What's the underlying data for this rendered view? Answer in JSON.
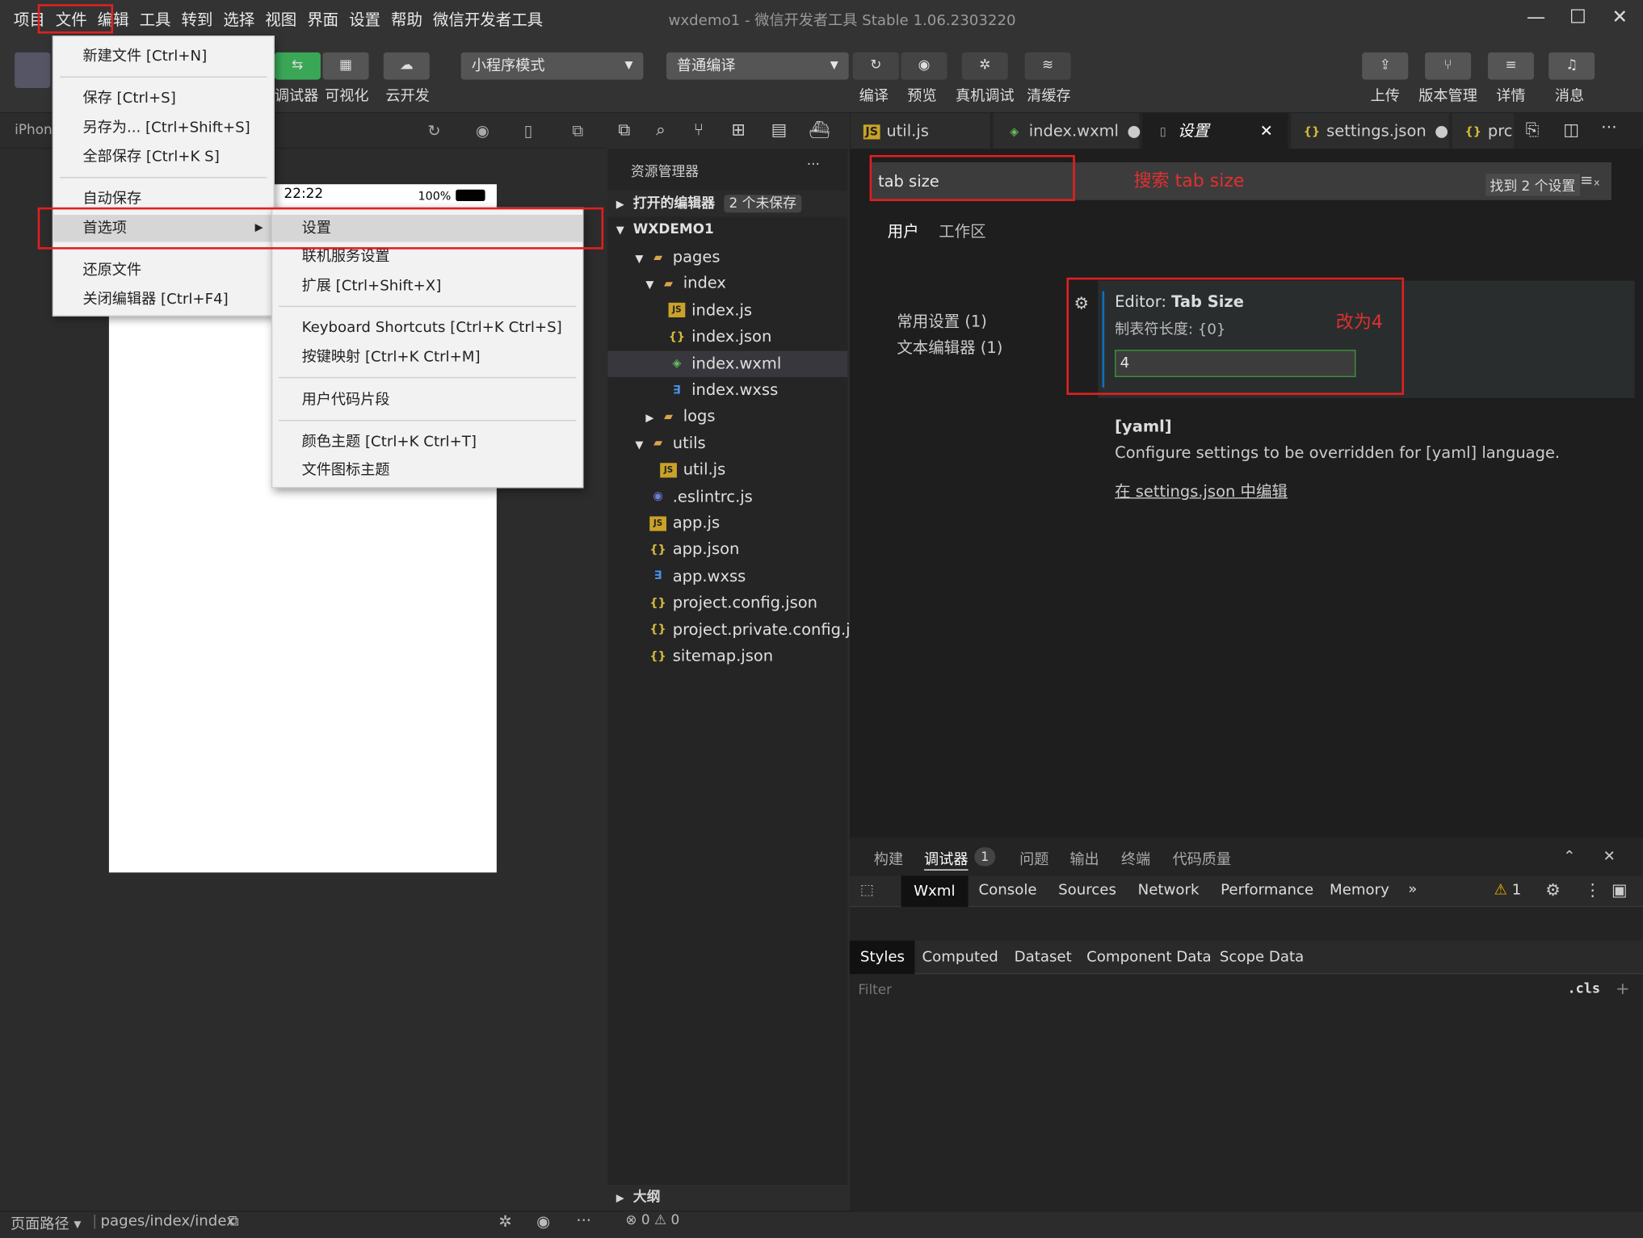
{
  "window": {
    "title": "wxdemo1 - 微信开发者工具 Stable 1.06.2303220",
    "menu": [
      "项目",
      "文件",
      "编辑",
      "工具",
      "转到",
      "选择",
      "视图",
      "界面",
      "设置",
      "帮助",
      "微信开发者工具"
    ],
    "controls": {
      "minimize": "—",
      "maximize": "☐",
      "close": "✕"
    }
  },
  "toolbar": {
    "left_labels": [
      "调试器",
      "可视化",
      "云开发"
    ],
    "mode_select": "小程序模式",
    "compile_select": "普通编译",
    "mid_labels": [
      "编译",
      "预览",
      "真机调试",
      "清缓存"
    ],
    "right_labels": [
      "上传",
      "版本管理",
      "详情",
      "消息"
    ]
  },
  "simulator": {
    "device": "iPhone",
    "time": "22:22",
    "battery": "100%"
  },
  "file_menu": {
    "items": [
      "新建文件 [Ctrl+N]",
      "保存 [Ctrl+S]",
      "另存为... [Ctrl+Shift+S]",
      "全部保存 [Ctrl+K S]",
      "自动保存",
      "首选项",
      "还原文件",
      "关闭编辑器 [Ctrl+F4]"
    ]
  },
  "pref_submenu": {
    "items": [
      "设置",
      "联机服务设置",
      "扩展 [Ctrl+Shift+X]",
      "Keyboard Shortcuts [Ctrl+K Ctrl+S]",
      "按键映射 [Ctrl+K Ctrl+M]",
      "用户代码片段",
      "颜色主题 [Ctrl+K Ctrl+T]",
      "文件图标主题"
    ]
  },
  "explorer": {
    "title": "资源管理器",
    "more": "···",
    "open_editors": "打开的编辑器",
    "unsaved_badge": "2 个未保存",
    "project": "WXDEMO1",
    "tree": [
      {
        "name": "pages",
        "type": "folder",
        "arrow": "▾"
      },
      {
        "name": "index",
        "type": "folder",
        "arrow": "▾"
      },
      {
        "name": "index.js",
        "type": "js"
      },
      {
        "name": "index.json",
        "type": "json"
      },
      {
        "name": "index.wxml",
        "type": "wxml"
      },
      {
        "name": "index.wxss",
        "type": "wxss"
      },
      {
        "name": "logs",
        "type": "folder",
        "arrow": "▸"
      },
      {
        "name": "utils",
        "type": "folder",
        "arrow": "▾"
      },
      {
        "name": "util.js",
        "type": "js"
      },
      {
        "name": ".eslintrc.js",
        "type": "eslint"
      },
      {
        "name": "app.js",
        "type": "js"
      },
      {
        "name": "app.json",
        "type": "json"
      },
      {
        "name": "app.wxss",
        "type": "wxss"
      },
      {
        "name": "project.config.json",
        "type": "json"
      },
      {
        "name": "project.private.config.js...",
        "type": "json"
      },
      {
        "name": "sitemap.json",
        "type": "json"
      }
    ],
    "outline": "大纲"
  },
  "tabs": [
    "util.js",
    "index.wxml",
    "设置",
    "settings.json",
    "prc"
  ],
  "settings": {
    "search_value": "tab size",
    "result_count": "找到 2 个设置",
    "scope_tabs": [
      "用户",
      "工作区"
    ],
    "toc": [
      "常用设置 (1)",
      "文本编辑器 (1)"
    ],
    "setting_title_prefix": "Editor: ",
    "setting_title": "Tab Size",
    "setting_desc": "制表符长度: {0}",
    "setting_value": "4",
    "yaml_title": "[yaml]",
    "yaml_desc": "Configure settings to be overridden for [yaml] language.",
    "yaml_link": "在 settings.json 中编辑"
  },
  "annotations": {
    "search_note": "搜索 tab size",
    "change_note": "改为4"
  },
  "panel": {
    "tabs": [
      "构建",
      "调试器",
      "问题",
      "输出",
      "终端",
      "代码质量"
    ],
    "debugger_badge": "1",
    "devtools_tabs": [
      "Wxml",
      "Console",
      "Sources",
      "Network",
      "Performance",
      "Memory",
      "»"
    ],
    "warn_count": "1",
    "style_tabs": [
      "Styles",
      "Computed",
      "Dataset",
      "Component Data",
      "Scope Data"
    ],
    "filter_placeholder": "Filter",
    "cls": ".cls",
    "plus": "+"
  },
  "statusbar": {
    "path_label": "页面路径 ▾",
    "path": "pages/index/index",
    "errors": "0",
    "warnings": "0"
  },
  "colors": {
    "accent_red": "#e02020",
    "green_input": "#3a9a3a"
  }
}
